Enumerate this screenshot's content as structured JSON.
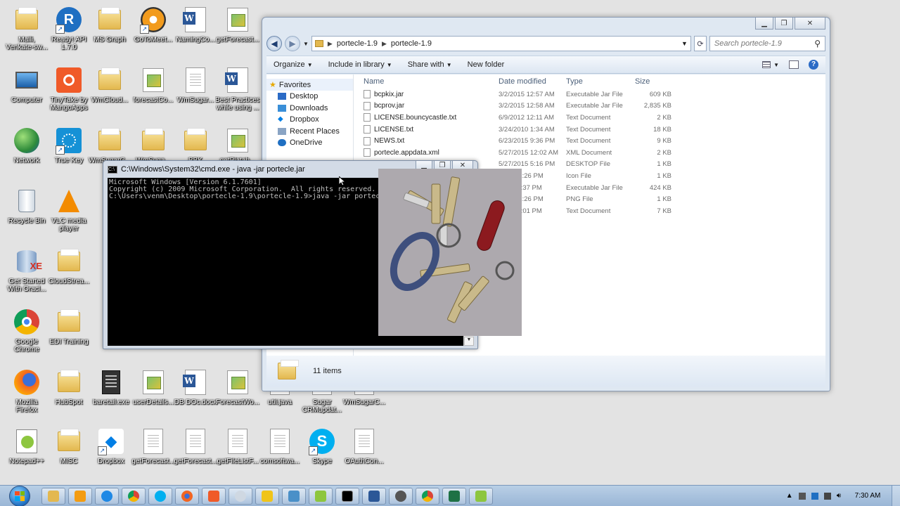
{
  "desktop_icons": [
    {
      "label": "Malli, Venkate-sw..."
    },
    {
      "label": "Ready! API 1.7.0"
    },
    {
      "label": "MS Graph"
    },
    {
      "label": "GoToMeet..."
    },
    {
      "label": "NamingCo..."
    },
    {
      "label": "getForecast..."
    },
    {
      "label": "Computer"
    },
    {
      "label": "TinyTake by MangoApps"
    },
    {
      "label": "WmCloud..."
    },
    {
      "label": "forecastCo..."
    },
    {
      "label": "WmSugar..."
    },
    {
      "label": "Best Practices while using ..."
    },
    {
      "label": "Network"
    },
    {
      "label": "True Key"
    },
    {
      "label": "WmSugarC..."
    },
    {
      "label": "WmSuga..."
    },
    {
      "label": "BBK"
    },
    {
      "label": "getPlatab..."
    },
    {
      "label": "Recycle Bin"
    },
    {
      "label": "VLC media player"
    },
    {
      "label": "Get Started With Oracl..."
    },
    {
      "label": "CloudStrea..."
    },
    {
      "label": "Google Chrome"
    },
    {
      "label": "EDI Training"
    },
    {
      "label": "Mozilla Firefox"
    },
    {
      "label": "HubSpot"
    },
    {
      "label": "baretail.exe"
    },
    {
      "label": "userDetails..."
    },
    {
      "label": "DB DOc.docx"
    },
    {
      "label": "ForecastWo..."
    },
    {
      "label": "util.java"
    },
    {
      "label": "Sugar CRMupdat..."
    },
    {
      "label": "WmSugarC..."
    },
    {
      "label": "Notepad++"
    },
    {
      "label": "MISC"
    },
    {
      "label": "Dropbox"
    },
    {
      "label": "getForecast..."
    },
    {
      "label": "getForecast..."
    },
    {
      "label": "getFileListF..."
    },
    {
      "label": "comsoftwa..."
    },
    {
      "label": "Skype"
    },
    {
      "label": "OAuthCon..."
    }
  ],
  "explorer": {
    "breadcrumb": [
      "portecle-1.9",
      "portecle-1.9"
    ],
    "search_placeholder": "Search portecle-1.9",
    "toolbar": {
      "organize": "Organize",
      "include_in_library": "Include in library",
      "share_with": "Share with",
      "new_folder": "New folder"
    },
    "nav": {
      "favorites": "Favorites",
      "items": [
        "Desktop",
        "Downloads",
        "Dropbox",
        "Recent Places",
        "OneDrive"
      ]
    },
    "columns": {
      "name": "Name",
      "date": "Date modified",
      "type": "Type",
      "size": "Size"
    },
    "files": [
      {
        "name": "bcpkix.jar",
        "date": "3/2/2015 12:57 AM",
        "type": "Executable Jar File",
        "size": "609 KB"
      },
      {
        "name": "bcprov.jar",
        "date": "3/2/2015 12:58 AM",
        "type": "Executable Jar File",
        "size": "2,835 KB"
      },
      {
        "name": "LICENSE.bouncycastle.txt",
        "date": "6/9/2012 12:11 AM",
        "type": "Text Document",
        "size": "2 KB"
      },
      {
        "name": "LICENSE.txt",
        "date": "3/24/2010 1:34 AM",
        "type": "Text Document",
        "size": "18 KB"
      },
      {
        "name": "NEWS.txt",
        "date": "6/23/2015 9:36 PM",
        "type": "Text Document",
        "size": "9 KB"
      },
      {
        "name": "portecle.appdata.xml",
        "date": "5/27/2015 12:02 AM",
        "type": "XML Document",
        "size": "2 KB"
      },
      {
        "name": "",
        "date": "5/27/2015 5:16 PM",
        "type": "DESKTOP File",
        "size": "1 KB"
      },
      {
        "name": "",
        "date": "2009 11:26 PM",
        "type": "Icon File",
        "size": "1 KB"
      },
      {
        "name": "",
        "date": "/2015 9:37 PM",
        "type": "Executable Jar File",
        "size": "424 KB"
      },
      {
        "name": "",
        "date": "2009 11:26 PM",
        "type": "PNG File",
        "size": "1 KB"
      },
      {
        "name": "",
        "date": "/2015 3:01 PM",
        "type": "Text Document",
        "size": "7 KB"
      }
    ],
    "item_count": "11 items"
  },
  "cmd": {
    "title": "C:\\Windows\\System32\\cmd.exe - java  -jar portecle.jar",
    "lines": [
      "Microsoft Windows [Version 6.1.7601]",
      "Copyright (c) 2009 Microsoft Corporation.  All rights reserved.",
      "",
      "C:\\Users\\venm\\Desktop\\portecle-1.9\\portecle-1.9>java -jar portecle.jar"
    ]
  },
  "taskbar": {
    "clock": "7:30 AM",
    "apps": [
      "explorer",
      "media-player",
      "ie",
      "chrome",
      "skype",
      "firefox",
      "tinytake",
      "search",
      "outlook",
      "remote",
      "notepad",
      "cmd",
      "word",
      "settings",
      "chrome-2",
      "excel",
      "notepad-2"
    ]
  },
  "colors": {
    "taskbar": "#9ab6d6",
    "console_bg": "#000000",
    "accent": "#2b6bc6"
  }
}
